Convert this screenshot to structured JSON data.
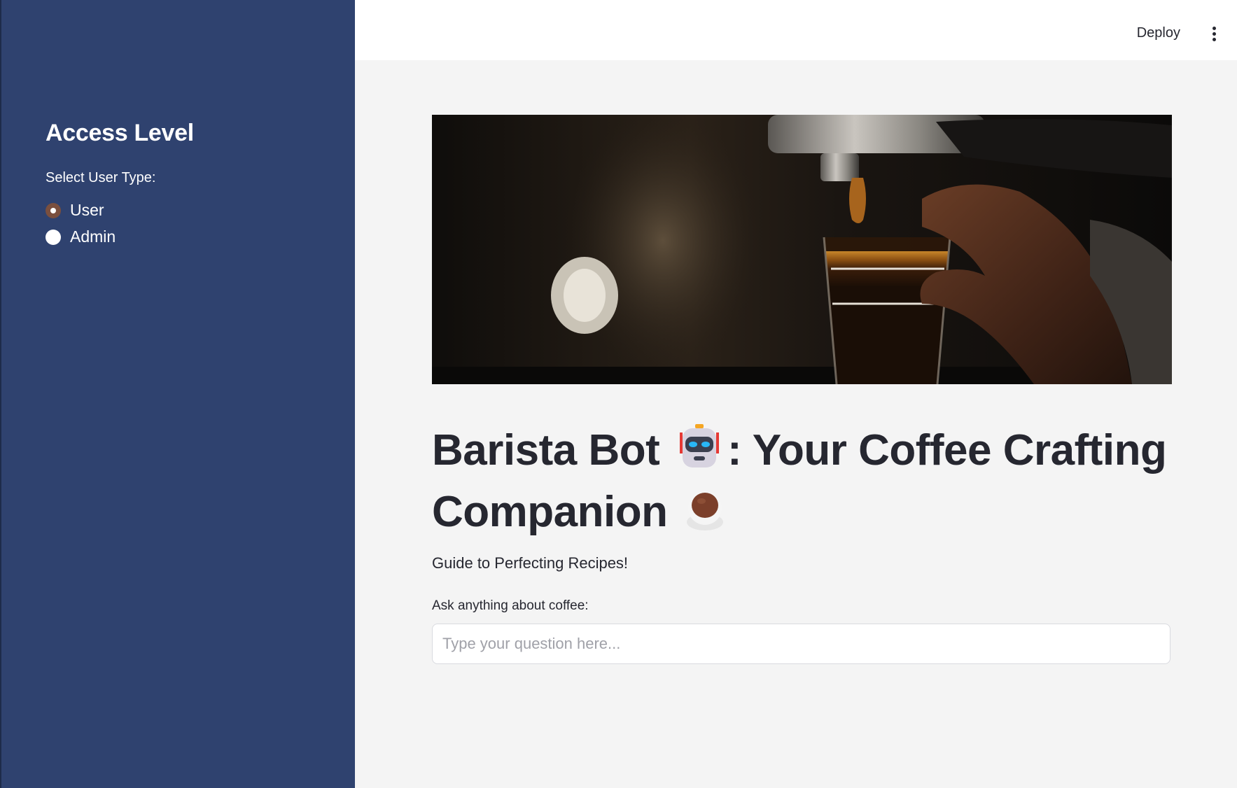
{
  "sidebar": {
    "title": "Access Level",
    "radio_label": "Select User Type:",
    "options": [
      {
        "label": "User",
        "selected": true
      },
      {
        "label": "Admin",
        "selected": false
      }
    ]
  },
  "topbar": {
    "deploy_label": "Deploy",
    "menu_icon": "more-vertical-icon"
  },
  "hero": {
    "description": "espresso-shot-hero-image"
  },
  "main": {
    "title_part1": "Barista Bot",
    "title_part2": ": Your Coffee Crafting Companion",
    "title_emoji1": "robot-icon",
    "title_emoji2": "coffee-cup-icon",
    "subtitle": "Guide to Perfecting Recipes!",
    "input_label": "Ask anything about coffee:",
    "input_placeholder": "Type your question here...",
    "input_value": ""
  },
  "colors": {
    "sidebar_bg": "#2f426f",
    "main_bg": "#f4f4f4",
    "radio_accent": "#7a4f3e",
    "text": "#262730"
  }
}
